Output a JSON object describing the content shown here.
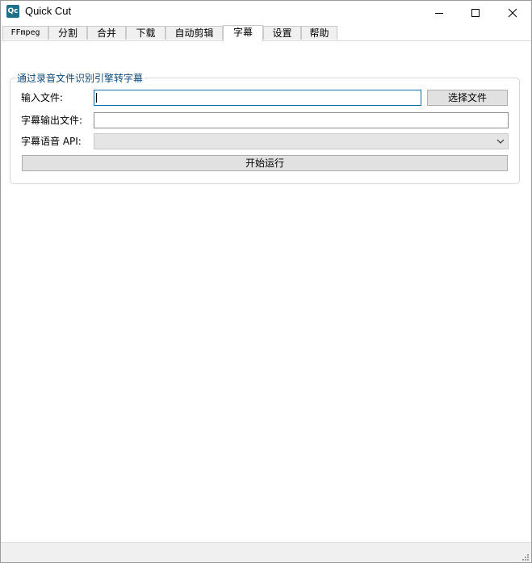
{
  "window": {
    "title": "Quick Cut",
    "icon_text": "Qc"
  },
  "tabs": [
    {
      "label": "FFmpeg"
    },
    {
      "label": "分割"
    },
    {
      "label": "合并"
    },
    {
      "label": "下载"
    },
    {
      "label": "自动剪辑"
    },
    {
      "label": "字幕",
      "active": true
    },
    {
      "label": "设置"
    },
    {
      "label": "帮助"
    }
  ],
  "group": {
    "title": "通过录音文件识别引擎转字幕",
    "input_file_label": "输入文件:",
    "input_file_value": "",
    "choose_file_button": "选择文件",
    "output_file_label": "字幕输出文件:",
    "output_file_value": "",
    "api_label": "字幕语音 API:",
    "api_selected": "",
    "run_button": "开始运行"
  },
  "icons": {
    "minimize": "minimize-icon",
    "maximize": "maximize-icon",
    "close": "close-icon",
    "dropdown": "chevron-down-icon",
    "grip": "resize-grip-icon"
  },
  "colors": {
    "accent": "#0d6ea8",
    "group_title": "#0d4a7a",
    "app_icon": "#1f6f8b"
  }
}
